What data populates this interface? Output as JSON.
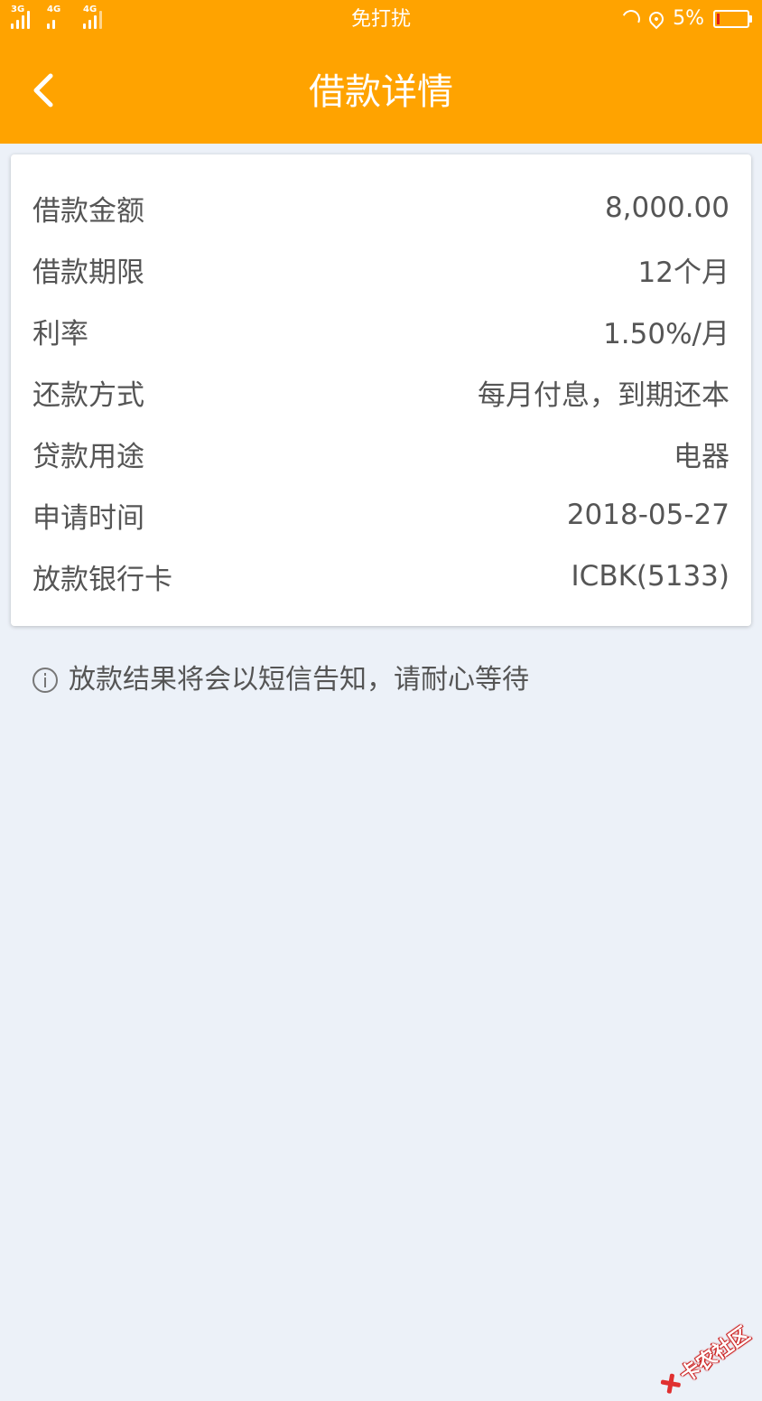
{
  "status_bar": {
    "network_1": "3G",
    "network_2": "4G",
    "network_3": "4G",
    "center_text": "免打扰",
    "battery_text": "5%",
    "battery_level": 0.05,
    "battery_color": "#e0201b",
    "icons": [
      "signal-icon",
      "moon-icon",
      "location-icon",
      "battery-icon"
    ]
  },
  "app_bar": {
    "title": "借款详情",
    "back_icon": "chevron-left-icon",
    "color": "#ffa300"
  },
  "details": {
    "rows": [
      {
        "label": "借款金额",
        "value": "8,000.00"
      },
      {
        "label": "借款期限",
        "value": "12个月"
      },
      {
        "label": "利率",
        "value": "1.50%/月"
      },
      {
        "label": "还款方式",
        "value": "每月付息，到期还本"
      },
      {
        "label": "贷款用途",
        "value": "电器"
      },
      {
        "label": "申请时间",
        "value": "2018-05-27"
      },
      {
        "label": "放款银行卡",
        "value": "ICBK(5133)"
      }
    ]
  },
  "notice": {
    "icon": "info-icon",
    "text": "放款结果将会以短信告知，请耐心等待"
  },
  "watermark": {
    "text": "卡农社区"
  }
}
